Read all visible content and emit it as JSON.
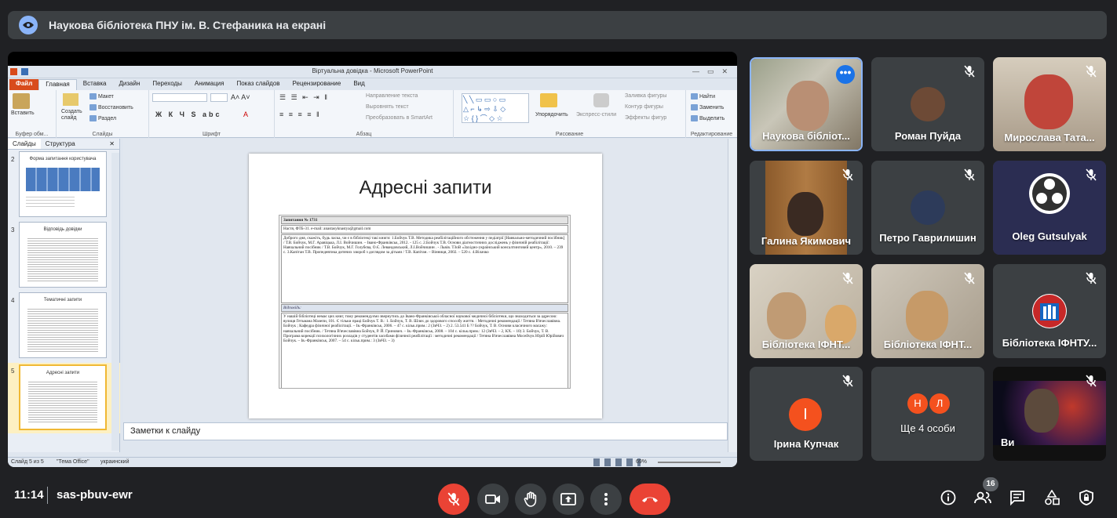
{
  "topbar": {
    "title": "Наукова бібліотека ПНУ ім. В. Стефаника на екрані"
  },
  "ppt": {
    "window_title": "Віртуальна довідка - Microsoft PowerPoint",
    "tabs": [
      "Файл",
      "Главная",
      "Вставка",
      "Дизайн",
      "Переходы",
      "Анимация",
      "Показ слайдов",
      "Рецензирование",
      "Вид"
    ],
    "groups": {
      "clipboard": "Буфер обм...",
      "slides": "Слайды",
      "font": "Шрифт",
      "paragraph": "Абзац",
      "drawing": "Рисование",
      "editing": "Редактирование"
    },
    "ribbon": {
      "paste": "Вставить",
      "new_slide": "Создать слайд",
      "layout": "Макет",
      "reset": "Восстановить",
      "section": "Раздел",
      "text_dir": "Направление текста",
      "align_text": "Выровнять текст",
      "smartart": "Преобразовать в SmartArt",
      "arrange": "Упорядочить",
      "quick_styles": "Экспресс-стили",
      "fill": "Заливка фигуры",
      "outline": "Контур фигуры",
      "effects": "Эффекты фигур",
      "find": "Найти",
      "replace": "Заменить",
      "select": "Выделить"
    },
    "pane_tabs": [
      "Слайды",
      "Структура"
    ],
    "thumbnails": [
      {
        "num": "2",
        "title": "Форма запитання користувача"
      },
      {
        "num": "3",
        "title": "Відповідь довідки"
      },
      {
        "num": "4",
        "title": "Тематичні запити"
      },
      {
        "num": "5",
        "title": "Адресні запити"
      }
    ],
    "slide": {
      "title": "Адресні запити",
      "doc_header": "Запитання № 1731",
      "doc_from": "Настя, ФТБ-31. e-mail: anastasyknastya@gmail.com",
      "doc_question": "Доброго дня, скажіть, будь ласка, чи є в бібліотеці такі книги: 1.Бойчук Т.В. Методика реабілітаційного обстеження у педіатрії [Навчально-методичний посібник] / Т.В. Бойчук, М.Г. Аравіцька, Л.І. Войчишин. – Івано-Франківськ, 2012. - 125 с. 2.Бойчук Т.В. Основи діагностичних досліджень у фізичній реабілітації: Навчальний посібник / Т.В. Бойчук, М.Г. Голубєва, О.Є. Левандовський, Л.І.Войчишин . - Львів. ТЗоВ «Західно-український консалтинговий центр», 2010. – 239 с. 3.Капітан Т.В. Пропедевтика дитячих хвороб з доглядом за дітьми / Т.В. Капітан. – Вінниця, 2002. – 520 с. 4.Вілачко",
      "doc_answer_label": "Відповідь:",
      "doc_answer": "У нашій бібліотеці немає цих книг, тому рекомендуємо звернутись до Івано-Франківської обласної наукової медичної бібліотеки, що знаходиться за адресою: вулиця Гетьмана Мазепи, 101. Є тільки праці Бойчук Т. В.: 1. Бойчук, Т. В. Шлях до здорового способу життя. : Методичні рекомендації / Тетяна В'ячеславівна. Бойчук ; Кафедра фізичної реабілітації. – Ів.-Франківськ, 2006. – 47 с. кільк.прим.: 2 (ЗвЧЗ. – 2) 2. 53.541 Б ?? Бойчук, Т. В. Основи класичного масажу: навчальний посібник. / Тетяна В'ячеславівна Бойчук, Р. Й. Гринович. – Ів.-Франківськ, 2008. – 104 с. кільк.прим.: 12 (ЗвЧЗ. – 2, КХ. – 10) 3. Бойчук, Т. В. Програма корекції психологічних розладів у студентів засобами фізичної реабілітації : методичні рекомендації / Тетяна В'ячеславівна Мосейчук Юрій Юрійович Бойчук. – Ів.-Франківськ, 2007. – 54 с. кільк.прим.: 3 (ЗвЧЗ. – 3)"
    },
    "notes_placeholder": "Заметки к слайду",
    "status": {
      "slide_of": "Слайд 5 из 5",
      "theme": "\"Тема Office\"",
      "lang": "украинский",
      "zoom": "69%"
    }
  },
  "participants": [
    {
      "name": "Наукова бібліот...",
      "muted": false,
      "active": true
    },
    {
      "name": "Роман Пуйда",
      "muted": true
    },
    {
      "name": "Мирослава Тата...",
      "muted": true
    },
    {
      "name": "Галина Якимович",
      "muted": true
    },
    {
      "name": "Петро Гаврилишин",
      "muted": true
    },
    {
      "name": "Oleg Gutsulyak",
      "muted": true
    },
    {
      "name": "Бібліотека ІФНТ...",
      "muted": true
    },
    {
      "name": "Бібліотека ІФНТ...",
      "muted": true
    },
    {
      "name": "Бібліотека ІФНТУ...",
      "muted": true
    },
    {
      "name": "Ірина Купчак",
      "muted": true,
      "initial": "І"
    },
    {
      "name": "Ще 4 особи",
      "initials": [
        "Н",
        "Л"
      ]
    },
    {
      "name": "Ви",
      "muted": true
    }
  ],
  "meeting": {
    "time": "11:14",
    "code": "sas-pbuv-ewr",
    "participant_count": "16"
  },
  "colors": {
    "accent": "#8ab4f8",
    "red": "#ea4335",
    "bg": "#202124",
    "tile": "#3c4043"
  }
}
